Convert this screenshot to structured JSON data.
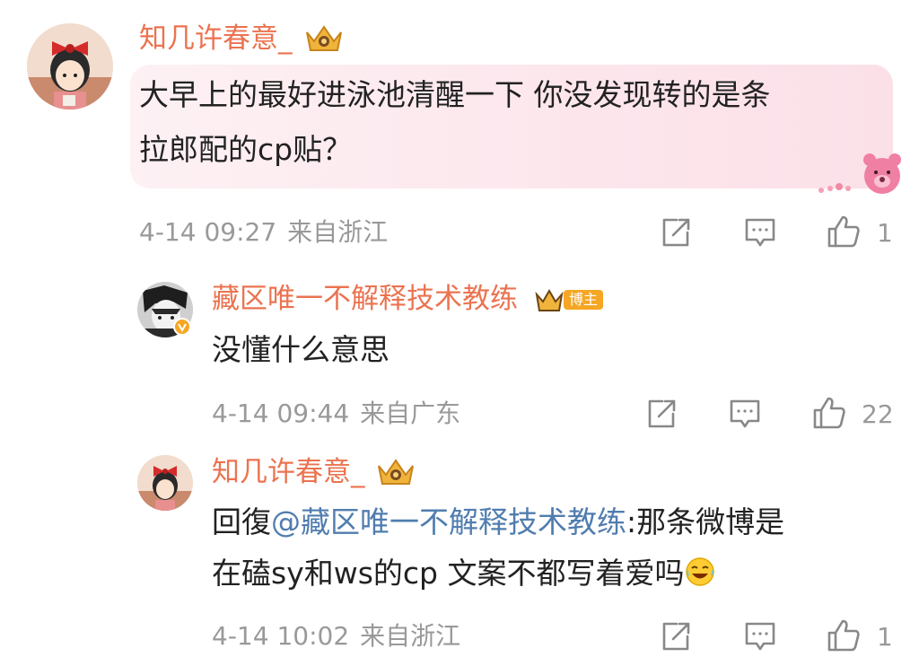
{
  "comments": [
    {
      "username": "知几许春意_",
      "text_line1": "大早上的最好进泳池清醒一下 你没发现转的是条",
      "text_line2": "拉郎配的cp贴？",
      "time": "4-14 09:27",
      "location": "来自浙江",
      "likes": "1"
    },
    {
      "username": "藏区唯一不解释技术教练",
      "badge": "博主",
      "text_line1": "没懂什么意思",
      "time": "4-14 09:44",
      "location": "来自广东",
      "likes": "22"
    },
    {
      "username": "知几许春意_",
      "reply_prefix": "回復",
      "mention": "@藏区唯一不解释技术教练",
      "text_line1_rest": ":那条微博是",
      "text_line2": "在磕sy和ws的cp 文案不都写着爱吗",
      "emoji": "laugh-cry-emoji",
      "time": "4-14 10:02",
      "location": "来自浙江",
      "likes": "1"
    }
  ],
  "colors": {
    "username": "#eb7350",
    "mention": "#507daf",
    "meta": "#999999",
    "text": "#222222"
  },
  "icons": [
    "share-icon",
    "comment-icon",
    "like-icon",
    "crown-badge-icon"
  ]
}
